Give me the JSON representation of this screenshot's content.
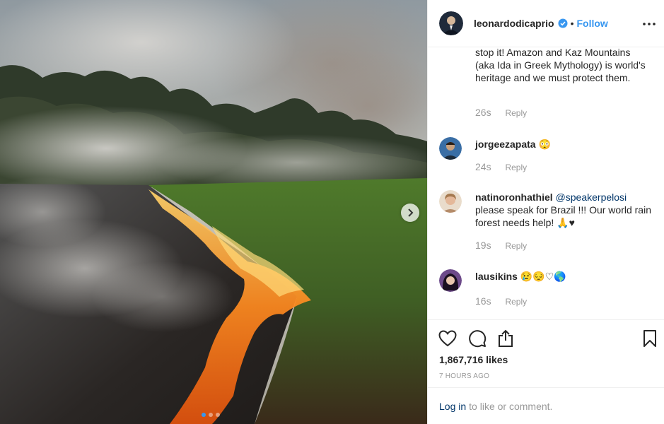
{
  "post": {
    "slide_count": 3,
    "active_slide": 1
  },
  "header": {
    "username": "leonardodicaprio",
    "separator": "•",
    "follow_label": "Follow"
  },
  "caption_tail": {
    "text": "stop it! Amazon and Kaz Mountains (aka Ida in Greek Mythology) is world's heritage and we must protect them.",
    "age": "26s",
    "reply_label": "Reply"
  },
  "comments": [
    {
      "username": "jorgeezapata",
      "mention": "",
      "text": "😳",
      "age": "24s",
      "reply_label": "Reply"
    },
    {
      "username": "natinoronhathiel",
      "mention": "@speakerpelosi",
      "text": "please speak for Brazil !!! Our world rain forest needs help! 🙏♥",
      "age": "19s",
      "reply_label": "Reply"
    },
    {
      "username": "lausikins",
      "mention": "",
      "text": "😢😔♡🌎",
      "age": "16s",
      "reply_label": "Reply"
    }
  ],
  "stats": {
    "likes": "1,867,716 likes",
    "posted": "7 HOURS AGO"
  },
  "login": {
    "link_label": "Log in",
    "rest": "to like or comment."
  },
  "colors": {
    "link_blue": "#3897f0",
    "mention_blue": "#003569",
    "muted": "#999999",
    "border": "#efefef"
  },
  "icons": [
    "verified-badge-icon",
    "more-options-icon",
    "heart-icon",
    "comment-icon",
    "share-icon",
    "bookmark-icon",
    "chevron-right-icon"
  ]
}
